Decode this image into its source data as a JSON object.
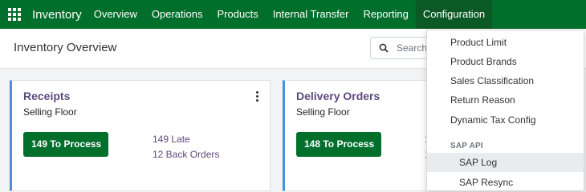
{
  "navbar": {
    "brand": "Inventory",
    "items": [
      {
        "label": "Overview"
      },
      {
        "label": "Operations"
      },
      {
        "label": "Products"
      },
      {
        "label": "Internal Transfer"
      },
      {
        "label": "Reporting"
      },
      {
        "label": "Configuration"
      }
    ],
    "active": "Configuration",
    "color": "#016f2c"
  },
  "control_panel": {
    "title": "Inventory Overview",
    "search_placeholder": "Search..."
  },
  "cards": [
    {
      "title": "Receipts",
      "subtitle": "Selling Floor",
      "button": "149 To Process",
      "late": "149 Late",
      "back_orders": "12 Back Orders"
    },
    {
      "title": "Delivery Orders",
      "subtitle": "Selling Floor",
      "button": "148 To Process",
      "peek1": "1",
      "peek2": "1"
    }
  ],
  "dropdown": {
    "items": [
      {
        "label": "Product Limit"
      },
      {
        "label": "Product Brands"
      },
      {
        "label": "Sales Classification"
      },
      {
        "label": "Return Reason"
      },
      {
        "label": "Dynamic Tax Config"
      }
    ],
    "section_header": "SAP API",
    "sub_items": [
      {
        "label": "SAP Log",
        "hover": true
      },
      {
        "label": "SAP Resync"
      }
    ]
  }
}
